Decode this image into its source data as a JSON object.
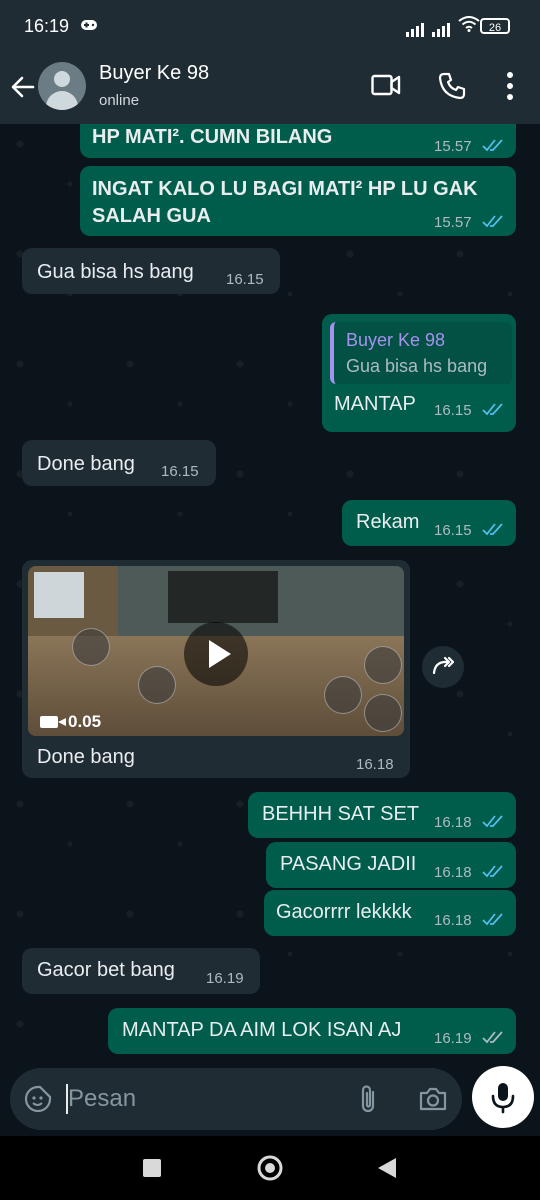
{
  "status_bar": {
    "time": "16:19",
    "battery": "26"
  },
  "header": {
    "contact_name": "Buyer Ke 98",
    "status": "online"
  },
  "messages": [
    {
      "text": "HP MATI². CUMN BILANG",
      "time": "15.57"
    },
    {
      "text1": "INGAT KALO LU BAGI MATI² HP LU GAK",
      "text2": "SALAH GUA",
      "time": "15.57"
    },
    {
      "text": "Gua bisa hs bang",
      "time": "16.15"
    },
    {
      "quote_name": "Buyer Ke 98",
      "quote_text": "Gua bisa hs bang",
      "text": "MANTAP",
      "time": "16.15"
    },
    {
      "text": "Done bang",
      "time": "16.15"
    },
    {
      "text": "Rekam",
      "time": "16.15"
    },
    {
      "video_duration": "0.05",
      "text": "Done bang",
      "time": "16.18"
    },
    {
      "text": "BEHHH SAT SET",
      "time": "16.18"
    },
    {
      "text": "PASANG JADII",
      "time": "16.18"
    },
    {
      "text": "Gacorrrr lekkkk",
      "time": "16.18"
    },
    {
      "text": "Gacor bet bang",
      "time": "16.19"
    },
    {
      "text": "MANTAP DA AIM LOK ISAN AJ",
      "time": "16.19"
    }
  ],
  "composer": {
    "placeholder": "Pesan"
  },
  "colors": {
    "outgoing": "#005c4b",
    "incoming": "#1f2c34",
    "read_tick": "#53bdeb",
    "background": "#0b141a"
  }
}
